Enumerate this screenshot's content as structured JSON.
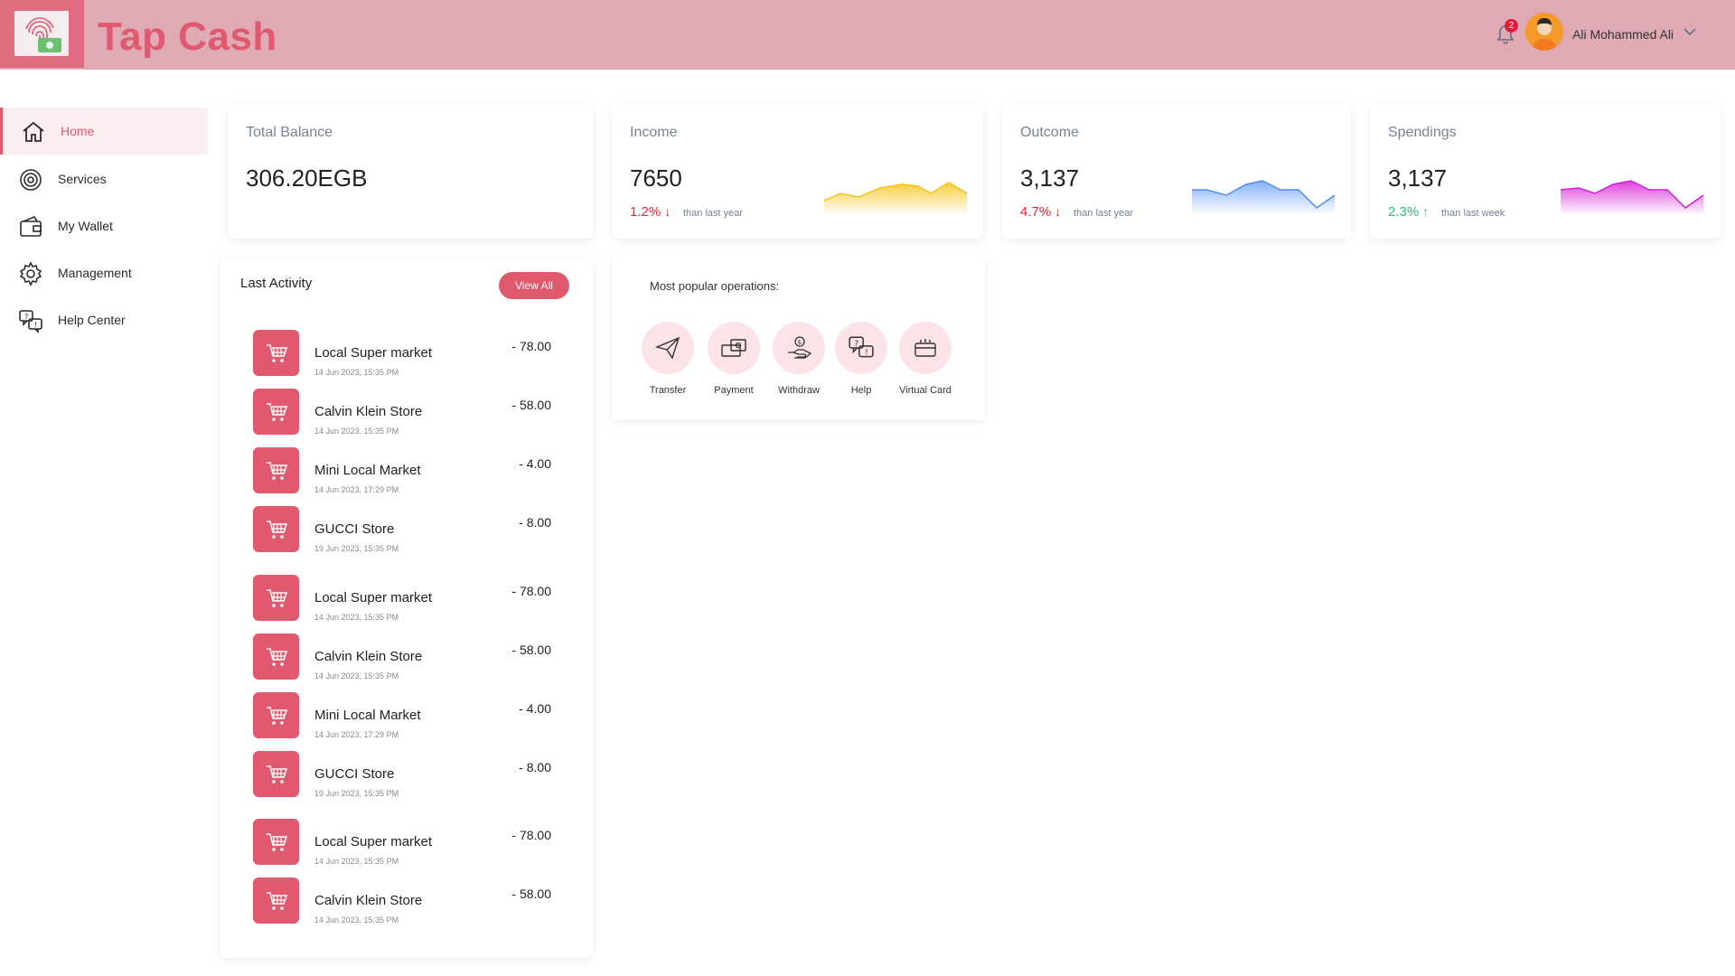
{
  "header": {
    "app_title": "Tap Cash",
    "notification_count": "2",
    "user_name": "Ali Mohammed Ali",
    "colors": {
      "header_bg": "#e0aab4",
      "brand": "#e0596f"
    }
  },
  "sidebar": {
    "items": [
      {
        "label": "Home",
        "icon": "home-icon",
        "active": true
      },
      {
        "label": "Services",
        "icon": "services-icon"
      },
      {
        "label": "My Wallet",
        "icon": "wallet-icon"
      },
      {
        "label": "Management",
        "icon": "gear-icon"
      },
      {
        "label": "Help Center",
        "icon": "help-chat-icon"
      }
    ]
  },
  "stats": {
    "total_balance": {
      "label": "Total Balance",
      "value": "306.20EGB"
    },
    "income": {
      "label": "Income",
      "value": "7650",
      "delta": "1.2%",
      "direction": "down",
      "caption": "than last year",
      "color": "#f5c518"
    },
    "outcome": {
      "label": "Outcome",
      "value": "3,137",
      "delta": "4.7%",
      "direction": "down",
      "caption": "than last year",
      "color": "#4e8ef7"
    },
    "spendings": {
      "label": "Spendings",
      "value": "3,137",
      "delta": "2.3%",
      "direction": "up",
      "caption": "than last week",
      "color": "#d81ed8"
    }
  },
  "activity": {
    "title": "Last Activity",
    "view_all_label": "View All",
    "items": [
      {
        "name": "Local Super market",
        "date": "14 Jun 2023, 15:35 PM",
        "amount": "- 78.00"
      },
      {
        "name": "Calvin Klein Store",
        "date": "14 Jun 2023, 15:35 PM",
        "amount": "- 58.00"
      },
      {
        "name": "Mini Local Market",
        "date": "14 Jun 2023, 17:29 PM",
        "amount": "- 4.00"
      },
      {
        "name": "GUCCI Store",
        "date": "19 Jun 2023, 15:35 PM",
        "amount": "- 8.00"
      },
      {
        "name": "Local Super market",
        "date": "14 Jun 2023, 15:35 PM",
        "amount": "- 78.00"
      },
      {
        "name": "Calvin Klein Store",
        "date": "14 Jun 2023, 15:35 PM",
        "amount": "- 58.00"
      },
      {
        "name": "Mini Local Market",
        "date": "14 Jun 2023, 17:29 PM",
        "amount": "- 4.00"
      },
      {
        "name": "GUCCI Store",
        "date": "19 Jun 2023, 15:35 PM",
        "amount": "- 8.00"
      },
      {
        "name": "Local Super market",
        "date": "14 Jun 2023, 15:35 PM",
        "amount": "- 78.00"
      },
      {
        "name": "Calvin Klein Store",
        "date": "14 Jun 2023, 15:35 PM",
        "amount": "- 58.00"
      }
    ]
  },
  "operations": {
    "title": "Most popular operations:",
    "items": [
      {
        "label": "Transfer",
        "icon": "paper-plane-icon"
      },
      {
        "label": "Payment",
        "icon": "payment-icon"
      },
      {
        "label": "Withdraw",
        "icon": "withdraw-hand-icon"
      },
      {
        "label": "Help",
        "icon": "help-chat-icon"
      },
      {
        "label": "Virtual Card",
        "icon": "virtual-card-icon"
      }
    ]
  }
}
